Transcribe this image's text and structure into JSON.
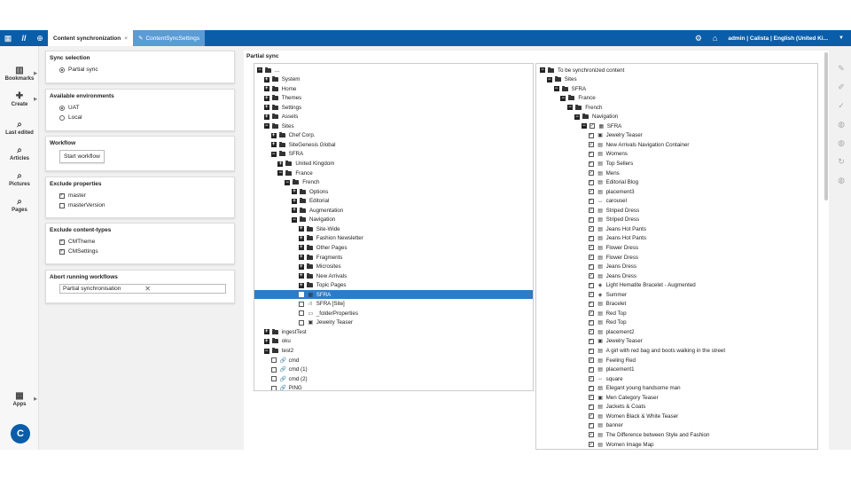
{
  "topbar": {
    "tabs": [
      {
        "label": "Content synchronization",
        "close": "×"
      },
      {
        "label": "ContentSyncSettings"
      }
    ],
    "user": "admin | Calista | English (United Ki..."
  },
  "leftnav": [
    "Bookmarks",
    "Create",
    "Last edited",
    "Articles",
    "Pictures",
    "Pages",
    "Apps"
  ],
  "settings": {
    "sync_selection": {
      "title": "Sync selection",
      "option": "Partial sync"
    },
    "environments": {
      "title": "Available environments",
      "options": [
        "UAT",
        "Local"
      ]
    },
    "workflow": {
      "title": "Workflow",
      "button": "Start workflow"
    },
    "exclude_props": {
      "title": "Exclude properties",
      "options": [
        "master",
        "masterVersion"
      ]
    },
    "exclude_types": {
      "title": "Exclude content-types",
      "options": [
        "CMTheme",
        "CMSettings"
      ]
    },
    "abort": {
      "title": "Abort running workflows",
      "value": "Partial synchronisation"
    }
  },
  "main": {
    "title": "Partial sync"
  },
  "left_tree": [
    {
      "t": "...",
      "l": 0,
      "pm": "−",
      "f": 1
    },
    {
      "t": "System",
      "l": 1,
      "pm": "+",
      "f": 1
    },
    {
      "t": "Home",
      "l": 1,
      "pm": "+",
      "f": 1
    },
    {
      "t": "Themes",
      "l": 1,
      "pm": "+",
      "f": 1
    },
    {
      "t": "Settings",
      "l": 1,
      "pm": "+",
      "f": 1
    },
    {
      "t": "Assets",
      "l": 1,
      "pm": "+",
      "f": 1
    },
    {
      "t": "Sites",
      "l": 1,
      "pm": "−",
      "f": 1
    },
    {
      "t": "Chef Corp.",
      "l": 2,
      "pm": "+",
      "f": 1
    },
    {
      "t": "SiteGenesis Global",
      "l": 2,
      "pm": "+",
      "f": 1
    },
    {
      "t": "SFRA",
      "l": 2,
      "pm": "−",
      "f": 1
    },
    {
      "t": "United Kingdom",
      "l": 3,
      "pm": "+",
      "f": 1
    },
    {
      "t": "France",
      "l": 3,
      "pm": "−",
      "f": 1
    },
    {
      "t": "French",
      "l": 4,
      "pm": "−",
      "f": 1
    },
    {
      "t": "Options",
      "l": 5,
      "pm": "+",
      "f": 1
    },
    {
      "t": "Editorial",
      "l": 5,
      "pm": "+",
      "f": 1
    },
    {
      "t": "Augmentation",
      "l": 5,
      "pm": "+",
      "f": 1
    },
    {
      "t": "Navigation",
      "l": 5,
      "pm": "−",
      "f": 1
    },
    {
      "t": "Site-Wide",
      "l": 6,
      "pm": "+",
      "f": 1
    },
    {
      "t": "Fashion Newsletter",
      "l": 6,
      "pm": "+",
      "f": 1
    },
    {
      "t": "Other Pages",
      "l": 6,
      "pm": "+",
      "f": 1
    },
    {
      "t": "Fragments",
      "l": 6,
      "pm": "+",
      "f": 1
    },
    {
      "t": "Microsites",
      "l": 6,
      "pm": "+",
      "f": 1
    },
    {
      "t": "New Arrivals",
      "l": 6,
      "pm": "+",
      "f": 1
    },
    {
      "t": "Topic Pages",
      "l": 6,
      "pm": "+",
      "f": 1
    },
    {
      "t": "SFRA",
      "l": 6,
      "cb": 1,
      "sel": 1,
      "ic": "▦"
    },
    {
      "t": "SFRA [Site]",
      "l": 6,
      "cb": 0,
      "ic": "⛙"
    },
    {
      "t": "_folderProperties",
      "l": 6,
      "cb": 0,
      "ic": "▭"
    },
    {
      "t": "Jewelry Teaser",
      "l": 6,
      "cb": 0,
      "ic": "▣"
    },
    {
      "t": "ingestTest",
      "l": 1,
      "pm": "+",
      "f": 1
    },
    {
      "t": "oku",
      "l": 1,
      "pm": "+",
      "f": 1
    },
    {
      "t": "test2",
      "l": 1,
      "pm": "−",
      "f": 1
    },
    {
      "t": "cmd",
      "l": 2,
      "cb": 0,
      "ic": "🔗"
    },
    {
      "t": "cmd (1)",
      "l": 2,
      "cb": 0,
      "ic": "🔗"
    },
    {
      "t": "cmd (2)",
      "l": 2,
      "cb": 0,
      "ic": "🔗"
    },
    {
      "t": "PING",
      "l": 2,
      "cb": 0,
      "ic": "🔗"
    }
  ],
  "right_tree": [
    {
      "t": "To be synchronized content",
      "l": 0,
      "pm": "−",
      "f": 1
    },
    {
      "t": "Sites",
      "l": 1,
      "pm": "−",
      "f": 1
    },
    {
      "t": "SFRA",
      "l": 2,
      "pm": "−",
      "f": 1
    },
    {
      "t": "France",
      "l": 3,
      "pm": "−",
      "f": 1
    },
    {
      "t": "French",
      "l": 4,
      "pm": "−",
      "f": 1
    },
    {
      "t": "Navigation",
      "l": 5,
      "pm": "−",
      "f": 1
    },
    {
      "t": "SFRA",
      "l": 6,
      "pm": "−",
      "cb": 1,
      "ic": "▦"
    },
    {
      "t": "Jewelry Teaser",
      "l": 7,
      "cb": 1,
      "ic": "▣"
    },
    {
      "t": "New Arrivals Navigation Container",
      "l": 7,
      "cb": 1,
      "ic": "▤"
    },
    {
      "t": "Womens",
      "l": 7,
      "cb": 1,
      "ic": "▤"
    },
    {
      "t": "Top Sellers",
      "l": 7,
      "cb": 1,
      "ic": "▤"
    },
    {
      "t": "Mens",
      "l": 7,
      "cb": 1,
      "ic": "▤"
    },
    {
      "t": "Editorial Blog",
      "l": 7,
      "cb": 1,
      "ic": "▤"
    },
    {
      "t": "placement3",
      "l": 7,
      "cb": 1,
      "ic": "▤"
    },
    {
      "t": "carousel",
      "l": 7,
      "cb": 1,
      "ic": "↔"
    },
    {
      "t": "Striped Dress",
      "l": 7,
      "cb": 1,
      "ic": "▤"
    },
    {
      "t": "Striped Dress",
      "l": 7,
      "cb": 1,
      "ic": "▤"
    },
    {
      "t": "Jeans Hot Pants",
      "l": 7,
      "cb": 1,
      "ic": "▤"
    },
    {
      "t": "Jeans Hot Pants",
      "l": 7,
      "cb": 1,
      "ic": "▤"
    },
    {
      "t": "Flower Dress",
      "l": 7,
      "cb": 1,
      "ic": "▤"
    },
    {
      "t": "Flower Dress",
      "l": 7,
      "cb": 1,
      "ic": "▤"
    },
    {
      "t": "Jeans Dress",
      "l": 7,
      "cb": 1,
      "ic": "▤"
    },
    {
      "t": "Jeans Dress",
      "l": 7,
      "cb": 1,
      "ic": "▤"
    },
    {
      "t": "Light Hematite Bracelet - Augmented",
      "l": 7,
      "cb": 1,
      "ic": "◈"
    },
    {
      "t": "Summer",
      "l": 7,
      "cb": 1,
      "ic": "◈"
    },
    {
      "t": "Bracelet",
      "l": 7,
      "cb": 1,
      "ic": "▤"
    },
    {
      "t": "Red Top",
      "l": 7,
      "cb": 1,
      "ic": "▤"
    },
    {
      "t": "Red Top",
      "l": 7,
      "cb": 1,
      "ic": "▤"
    },
    {
      "t": "placement2",
      "l": 7,
      "cb": 1,
      "ic": "▤"
    },
    {
      "t": "Jewelry Teaser",
      "l": 7,
      "cb": 1,
      "ic": "▣"
    },
    {
      "t": "A girl with red bag and boots walking in the street",
      "l": 7,
      "cb": 1,
      "ic": "▤"
    },
    {
      "t": "Feeling Red",
      "l": 7,
      "cb": 1,
      "ic": "▤"
    },
    {
      "t": "placement1",
      "l": 7,
      "cb": 1,
      "ic": "▤"
    },
    {
      "t": "square",
      "l": 7,
      "cb": 1,
      "ic": "↔"
    },
    {
      "t": "Elegant young handsome man",
      "l": 7,
      "cb": 1,
      "ic": "▤"
    },
    {
      "t": "Men Category Teaser",
      "l": 7,
      "cb": 1,
      "ic": "▣"
    },
    {
      "t": "Jackets & Coats",
      "l": 7,
      "cb": 1,
      "ic": "▤"
    },
    {
      "t": "Women Black & White Teaser",
      "l": 7,
      "cb": 1,
      "ic": "▤"
    },
    {
      "t": "banner",
      "l": 7,
      "cb": 1,
      "ic": "▤"
    },
    {
      "t": "The Difference between Style and Fashion",
      "l": 7,
      "cb": 1,
      "ic": "▤"
    },
    {
      "t": "Women Image Map",
      "l": 7,
      "cb": 1,
      "ic": "▤"
    }
  ]
}
